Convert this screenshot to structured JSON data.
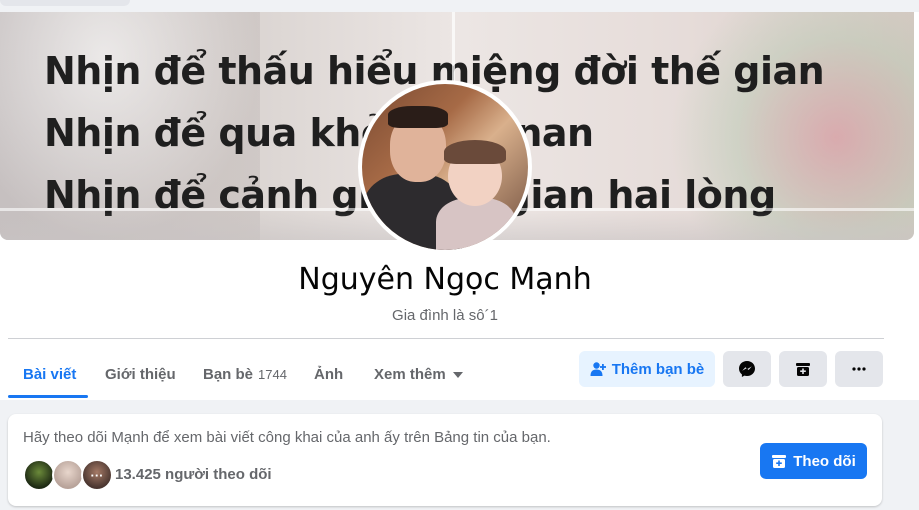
{
  "cover": {
    "lines": [
      "Nhịn để thấu hiểu miệng đời thế gian",
      "Nhịn để qua khỏi gian nan",
      "Nhịn để cảnh giới thế gian hai lòng"
    ]
  },
  "profile": {
    "name": "Nguyên Ngọc Mạnh",
    "bio": "Gia đình là sô´1"
  },
  "tabs": [
    {
      "label": "Bài viết"
    },
    {
      "label": "Giới thiệu"
    },
    {
      "label": "Bạn bè",
      "count": "1744"
    },
    {
      "label": "Ảnh"
    },
    {
      "label": "Xem thêm"
    }
  ],
  "actions": {
    "add_friend": "Thêm bạn bè"
  },
  "follow_card": {
    "message": "Hãy theo dõi Mạnh để xem bài viết công khai của anh ấy trên Bảng tin của bạn.",
    "followers": "13.425 người theo dõi",
    "follow_button": "Theo dõi",
    "more_dots": "···"
  },
  "colors": {
    "accent": "#1877f2",
    "accent_light": "#e7f3ff",
    "text_secondary": "#65676b",
    "background": "#f0f2f5"
  },
  "icons": [
    "user-plus-icon",
    "messenger-icon",
    "box-icon",
    "more-horizontal-icon",
    "add-follow-icon",
    "caret-down-icon"
  ]
}
